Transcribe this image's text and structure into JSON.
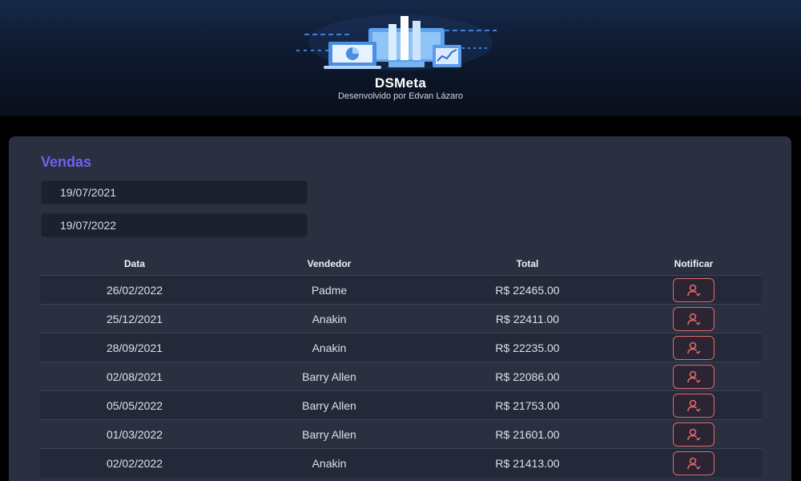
{
  "brand": {
    "title": "DSMeta",
    "subtitle": "Desenvolvido por Edvan Lázaro",
    "logo_icon": "dashboard-analytics-icon"
  },
  "sales_card": {
    "title": "Vendas",
    "min_date": "19/07/2021",
    "max_date": "19/07/2022",
    "columns": [
      "Data",
      "Vendedor",
      "Total",
      "Notificar"
    ],
    "rows": [
      {
        "date": "26/02/2022",
        "seller": "Padme",
        "total": "R$ 22465.00"
      },
      {
        "date": "25/12/2021",
        "seller": "Anakin",
        "total": "R$ 22411.00"
      },
      {
        "date": "28/09/2021",
        "seller": "Anakin",
        "total": "R$ 22235.00"
      },
      {
        "date": "02/08/2021",
        "seller": "Barry Allen",
        "total": "R$ 22086.00"
      },
      {
        "date": "05/05/2022",
        "seller": "Barry Allen",
        "total": "R$ 21753.00"
      },
      {
        "date": "01/03/2022",
        "seller": "Barry Allen",
        "total": "R$ 21601.00"
      },
      {
        "date": "02/02/2022",
        "seller": "Anakin",
        "total": "R$ 21413.00"
      }
    ],
    "notify_icon": "user-notify-icon"
  },
  "colors": {
    "accent": "#6d63ee",
    "notify": "#e06b6b",
    "card_bg": "#2a3040",
    "page_bg": "#000000"
  }
}
